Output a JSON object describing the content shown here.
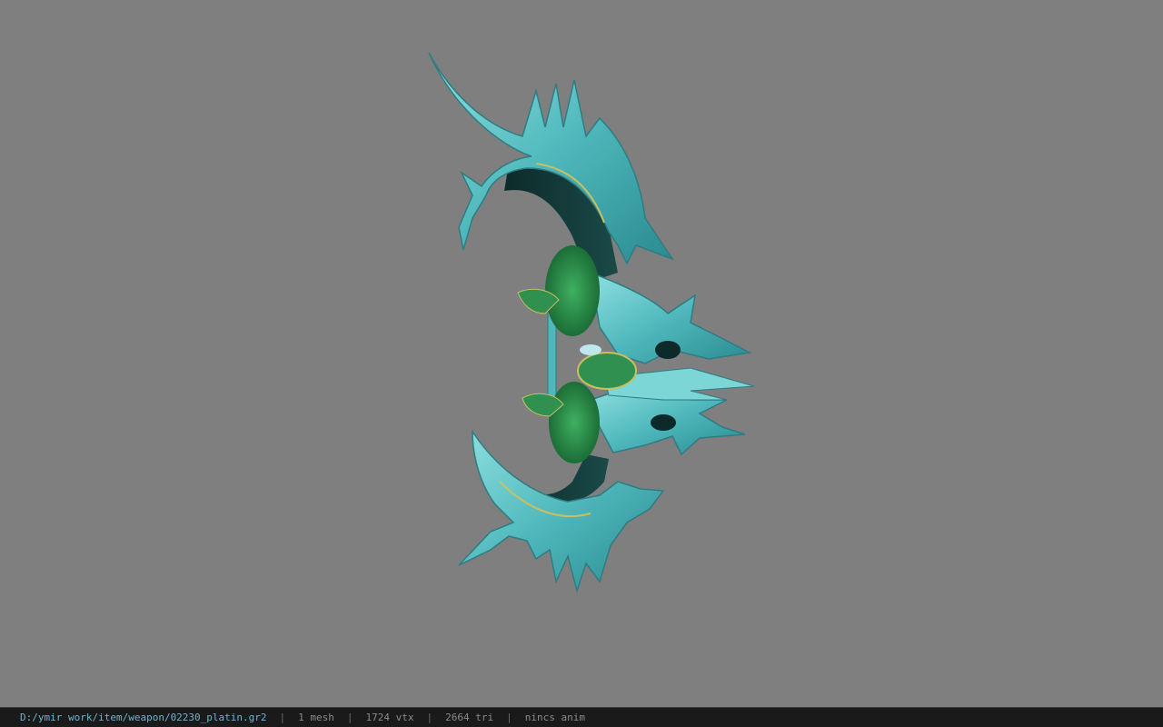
{
  "viewer": {
    "background_color": "#7f7f7f",
    "model": {
      "name": "02230_platin bow model",
      "primary_color": "#5fc2c4",
      "accent_color": "#1f8f45"
    }
  },
  "statusbar": {
    "file_path": "D:/ymir work/item/weapon/02230_platin.gr2",
    "separator": "|",
    "mesh_count": "1 mesh",
    "vertex_count": "1724 vtx",
    "triangle_count": "2664 tri",
    "animation": "nincs anim",
    "colors": {
      "background": "#1a1a1a",
      "path": "#6fb3cf",
      "stats": "#8a8a8a"
    }
  }
}
